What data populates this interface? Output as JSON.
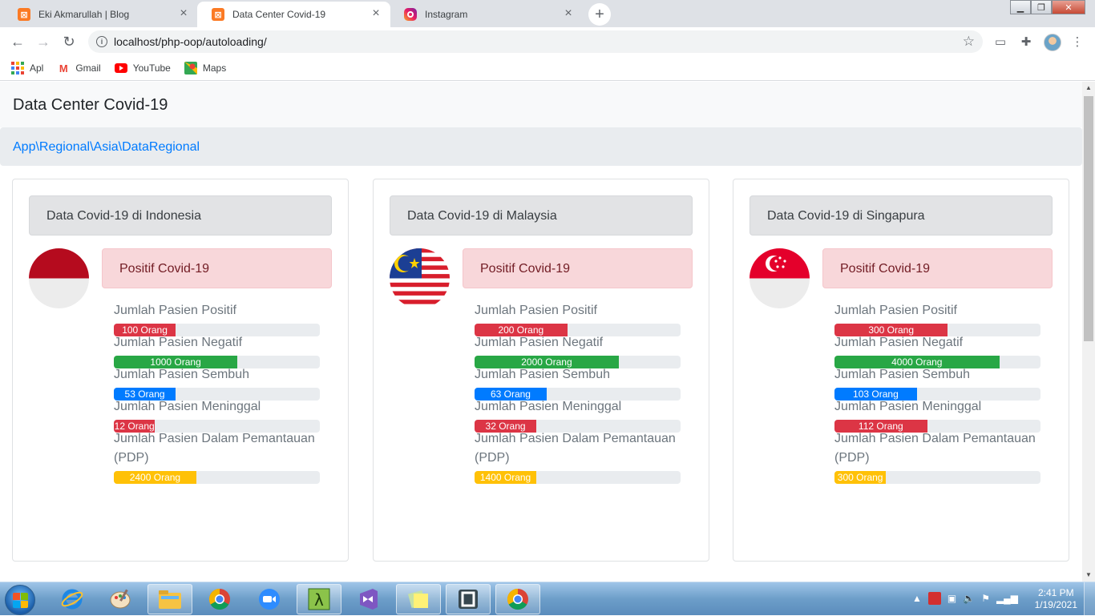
{
  "browser": {
    "tabs": [
      {
        "label": "Eki Akmarullah | Blog",
        "icon": "xampp-icon"
      },
      {
        "label": "Data Center Covid-19",
        "icon": "xampp-icon",
        "active": true
      },
      {
        "label": "Instagram",
        "icon": "instagram-icon"
      }
    ],
    "url": "localhost/php-oop/autoloading/",
    "bookmarks": [
      {
        "label": "Apl",
        "icon": "apps-grid-icon"
      },
      {
        "label": "Gmail",
        "icon": "gmail-icon"
      },
      {
        "label": "YouTube",
        "icon": "youtube-icon"
      },
      {
        "label": "Maps",
        "icon": "maps-icon"
      }
    ]
  },
  "page": {
    "title": "Data Center Covid-19",
    "breadcrumb": "App\\Regional\\Asia\\DataRegional",
    "alert_label": "Positif Covid-19",
    "stat_labels": {
      "positif": "Jumlah Pasien Positif",
      "negatif": "Jumlah Pasien Negatif",
      "sembuh": "Jumlah Pasien Sembuh",
      "meninggal": "Jumlah Pasien Meninggal",
      "pdp": "Jumlah Pasien Dalam Pemantauan (PDP)"
    },
    "colors": {
      "danger": "#dc3545",
      "success": "#28a745",
      "primary": "#007bff",
      "warning": "#ffc107"
    },
    "cards": [
      {
        "header": "Data Covid-19 di Indonesia",
        "flag": "indonesia-flag-icon",
        "stats": [
          {
            "key": "positif",
            "text": "100 Orang",
            "percent": 30,
            "color": "danger"
          },
          {
            "key": "negatif",
            "text": "1000 Orang",
            "percent": 60,
            "color": "success"
          },
          {
            "key": "sembuh",
            "text": "53 Orang",
            "percent": 30,
            "color": "primary"
          },
          {
            "key": "meninggal",
            "text": "12 Orang",
            "percent": 20,
            "color": "danger"
          },
          {
            "key": "pdp",
            "text": "2400 Orang",
            "percent": 40,
            "color": "warning"
          }
        ]
      },
      {
        "header": "Data Covid-19 di Malaysia",
        "flag": "malaysia-flag-icon",
        "stats": [
          {
            "key": "positif",
            "text": "200 Orang",
            "percent": 45,
            "color": "danger"
          },
          {
            "key": "negatif",
            "text": "2000 Orang",
            "percent": 70,
            "color": "success"
          },
          {
            "key": "sembuh",
            "text": "63 Orang",
            "percent": 35,
            "color": "primary"
          },
          {
            "key": "meninggal",
            "text": "32 Orang",
            "percent": 30,
            "color": "danger"
          },
          {
            "key": "pdp",
            "text": "1400 Orang",
            "percent": 30,
            "color": "warning"
          }
        ]
      },
      {
        "header": "Data Covid-19 di Singapura",
        "flag": "singapore-flag-icon",
        "stats": [
          {
            "key": "positif",
            "text": "300 Orang",
            "percent": 55,
            "color": "danger"
          },
          {
            "key": "negatif",
            "text": "4000 Orang",
            "percent": 80,
            "color": "success"
          },
          {
            "key": "sembuh",
            "text": "103 Orang",
            "percent": 40,
            "color": "primary"
          },
          {
            "key": "meninggal",
            "text": "112 Orang",
            "percent": 45,
            "color": "danger"
          },
          {
            "key": "pdp",
            "text": "300 Orang",
            "percent": 25,
            "color": "warning"
          }
        ]
      }
    ]
  },
  "taskbar": {
    "apps": [
      "internet-explorer-icon",
      "paint-icon",
      "file-explorer-icon",
      "chrome-icon",
      "zoom-icon",
      "lambda-icon",
      "visual-studio-icon",
      "sticky-notes-icon",
      "sublime-icon",
      "chrome-alt-icon"
    ],
    "clock_time": "2:41 PM",
    "clock_date": "1/19/2021"
  }
}
